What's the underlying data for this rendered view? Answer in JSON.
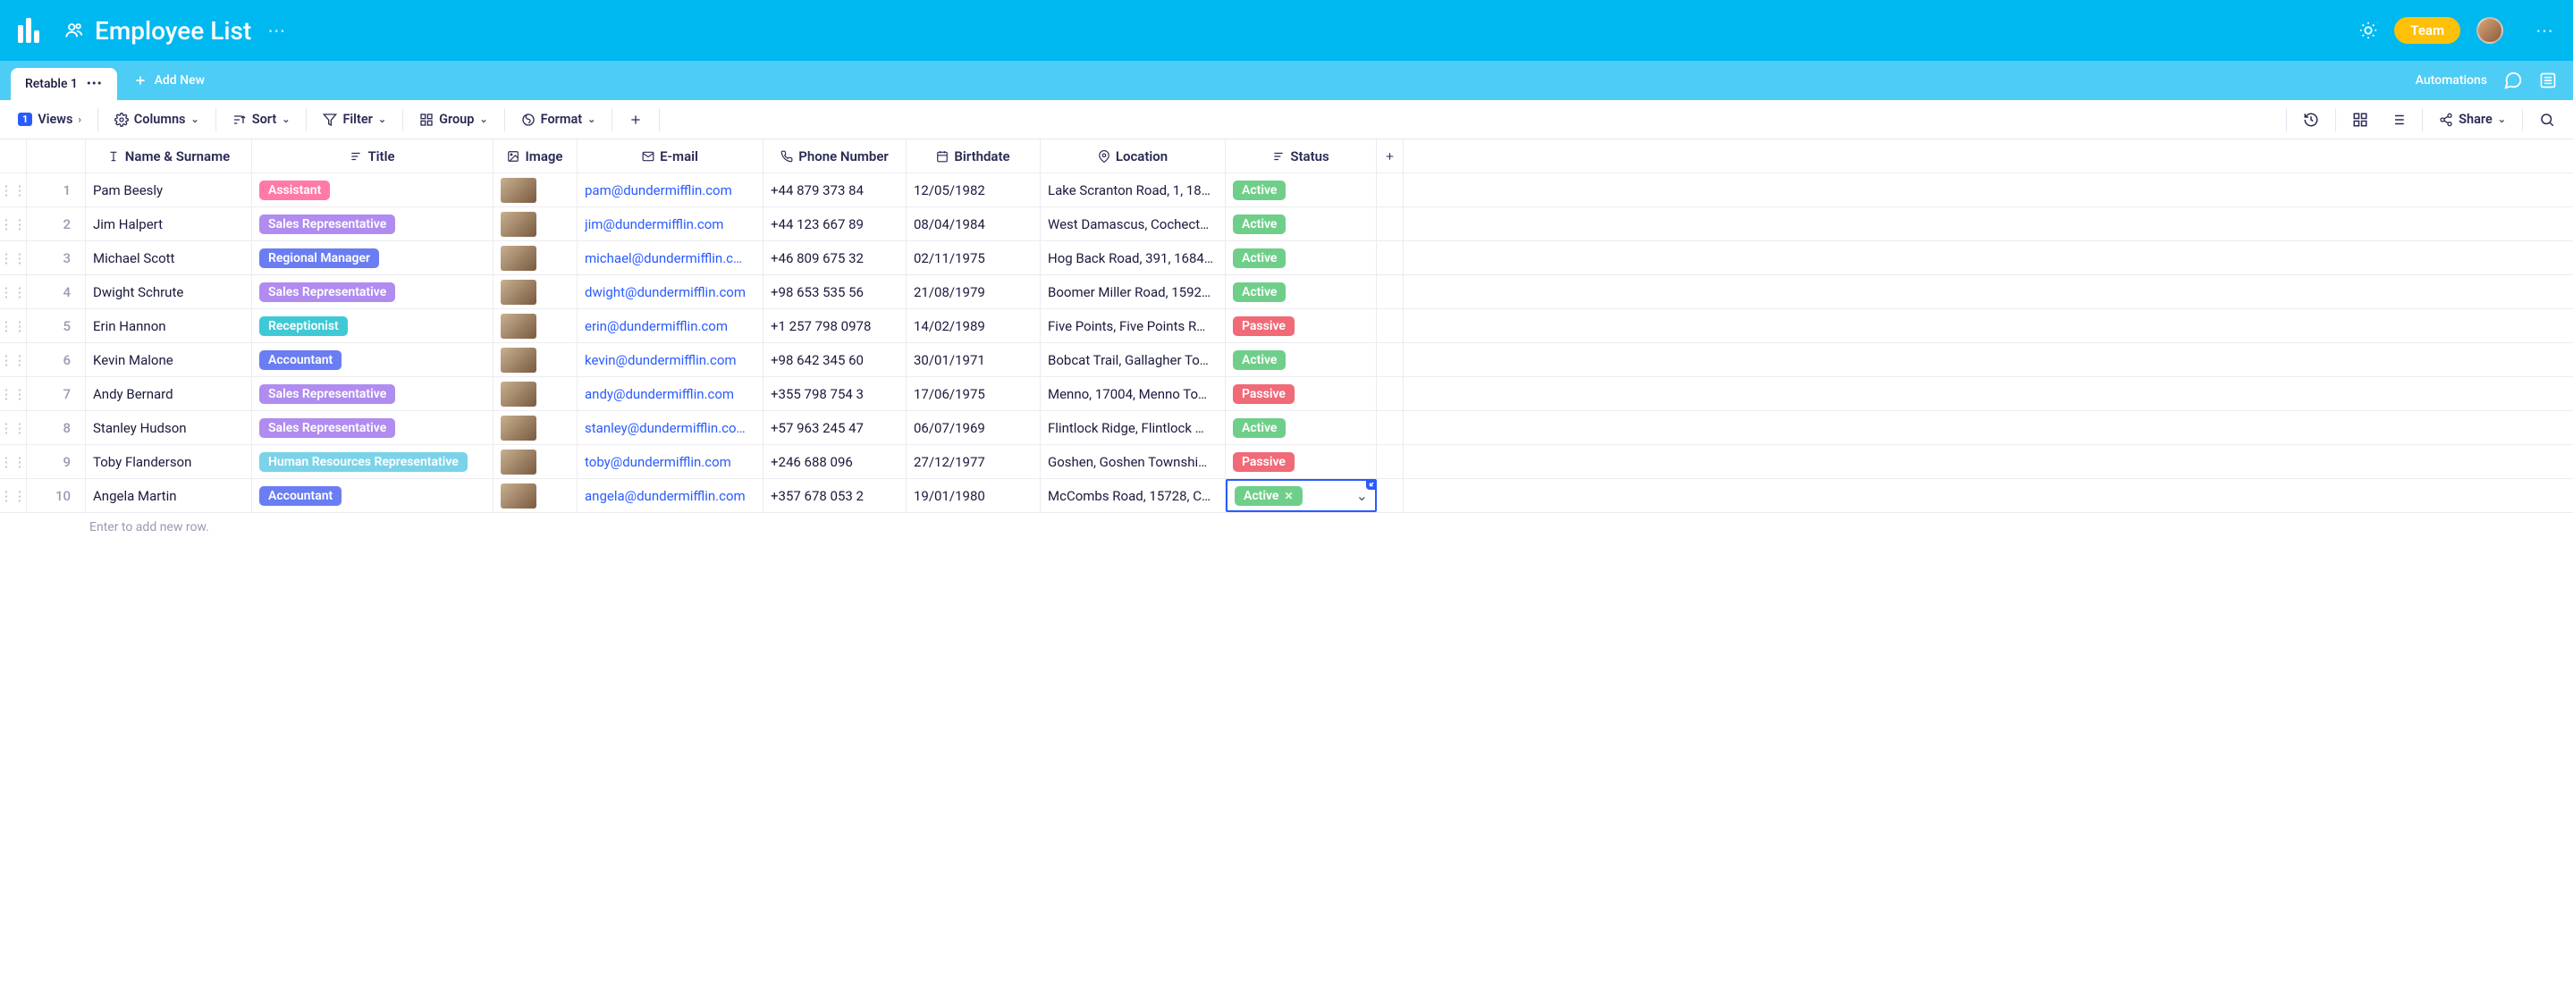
{
  "header": {
    "title": "Employee List",
    "team_label": "Team"
  },
  "tabs": {
    "active": "Retable 1",
    "add_new": "Add New",
    "automations": "Automations"
  },
  "toolbar": {
    "views_count": "1",
    "views": "Views",
    "columns": "Columns",
    "sort": "Sort",
    "filter": "Filter",
    "group": "Group",
    "format": "Format",
    "share": "Share"
  },
  "columns": {
    "name": "Name & Surname",
    "title": "Title",
    "image": "Image",
    "email": "E-mail",
    "phone": "Phone Number",
    "birthdate": "Birthdate",
    "location": "Location",
    "status": "Status"
  },
  "title_colors": {
    "Assistant": "#ff7aa8",
    "Sales Representative": "#b08cf0",
    "Regional Manager": "#6a7df2",
    "Receptionist": "#3fc9d6",
    "Accountant": "#6a7df2",
    "Human Resources Representative": "#7ad3e8"
  },
  "status_colors": {
    "Active": "#6fcf8a",
    "Passive": "#f06a78"
  },
  "rows": [
    {
      "n": "1",
      "name": "Pam Beesly",
      "title": "Assistant",
      "email": "pam@dundermifflin.com",
      "phone": "+44 879 373 84",
      "birth": "12/05/1982",
      "loc": "Lake Scranton Road, 1, 18…",
      "status": "Active"
    },
    {
      "n": "2",
      "name": "Jim Halpert",
      "title": "Sales Representative",
      "email": "jim@dundermifflin.com",
      "phone": "+44 123 667 89",
      "birth": "08/04/1984",
      "loc": "West Damascus, Cochect…",
      "status": "Active"
    },
    {
      "n": "3",
      "name": "Michael Scott",
      "title": "Regional Manager",
      "email": "michael@dundermifflin.c…",
      "phone": "+46 809 675 32",
      "birth": "02/11/1975",
      "loc": "Hog Back Road, 391, 1684…",
      "status": "Active"
    },
    {
      "n": "4",
      "name": "Dwight Schrute",
      "title": "Sales Representative",
      "email": "dwight@dundermifflin.com",
      "phone": "+98 653 535 56",
      "birth": "21/08/1979",
      "loc": "Boomer Miller Road, 1592…",
      "status": "Active"
    },
    {
      "n": "5",
      "name": "Erin Hannon",
      "title": "Receptionist",
      "email": "erin@dundermifflin.com",
      "phone": "+1 257 798 0978",
      "birth": "14/02/1989",
      "loc": "Five Points, Five Points R…",
      "status": "Passive"
    },
    {
      "n": "6",
      "name": "Kevin Malone",
      "title": "Accountant",
      "email": "kevin@dundermifflin.com",
      "phone": "+98 642 345 60",
      "birth": "30/01/1971",
      "loc": "Bobcat Trail, Gallagher To…",
      "status": "Active"
    },
    {
      "n": "7",
      "name": "Andy Bernard",
      "title": "Sales Representative",
      "email": "andy@dundermifflin.com",
      "phone": "+355 798 754 3",
      "birth": "17/06/1975",
      "loc": "Menno, 17004, Menno To…",
      "status": "Passive"
    },
    {
      "n": "8",
      "name": "Stanley Hudson",
      "title": "Sales Representative",
      "email": "stanley@dundermifflin.co…",
      "phone": "+57 963 245 47",
      "birth": "06/07/1969",
      "loc": "Flintlock Ridge, Flintlock …",
      "status": "Active"
    },
    {
      "n": "9",
      "name": "Toby Flanderson",
      "title": "Human Resources Representative",
      "email": "toby@dundermifflin.com",
      "phone": "+246 688 096",
      "birth": "27/12/1977",
      "loc": "Goshen, Goshen Townshi…",
      "status": "Passive"
    },
    {
      "n": "10",
      "name": "Angela Martin",
      "title": "Accountant",
      "email": "angela@dundermifflin.com",
      "phone": "+357 678 053 2",
      "birth": "19/01/1980",
      "loc": "McCombs Road, 15728, C…",
      "status": "Active",
      "selected": true
    }
  ],
  "add_row_placeholder": "Enter to add new row."
}
